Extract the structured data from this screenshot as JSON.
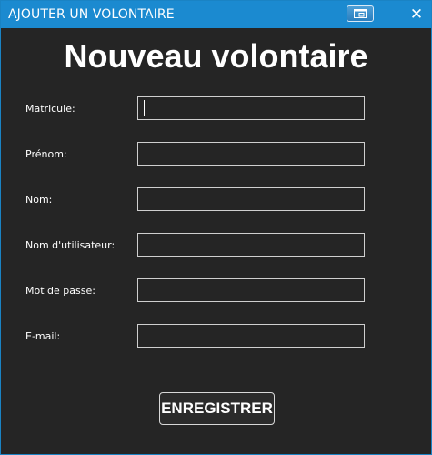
{
  "window": {
    "title": "AJOUTER UN VOLONTAIRE",
    "restore_icon": "window-restore-icon",
    "close_icon": "close-icon",
    "close_glyph": "✕"
  },
  "form": {
    "heading": "Nouveau volontaire",
    "fields": [
      {
        "label": "Matricule:",
        "value": "",
        "focused": true
      },
      {
        "label": "Prénom:",
        "value": ""
      },
      {
        "label": "Nom:",
        "value": ""
      },
      {
        "label": "Nom d'utilisateur:",
        "value": ""
      },
      {
        "label": "Mot de passe:",
        "value": ""
      },
      {
        "label": "E-mail:",
        "value": ""
      }
    ],
    "submit_label": "ENREGISTRER"
  },
  "colors": {
    "titlebar": "#1b8ad0",
    "window_border": "#1a83c4",
    "background": "#252525",
    "text": "#ffffff",
    "input_border": "#cfcfcf"
  }
}
